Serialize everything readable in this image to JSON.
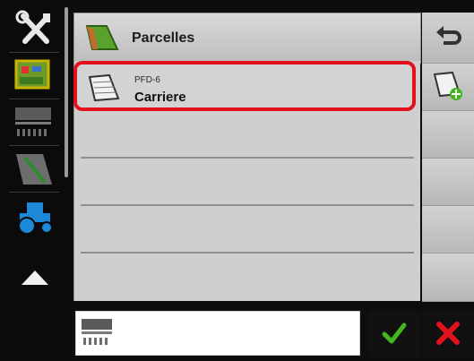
{
  "header": {
    "title": "Parcelles"
  },
  "field_list": {
    "selected": {
      "code": "PFD-6",
      "name": "Carriere"
    },
    "empty_rows": 3
  },
  "icons": {
    "sidebar": [
      "tools-icon",
      "field-map-icon",
      "implement-icon",
      "field-note-icon",
      "tractor-icon",
      "arrow-up-icon",
      "arrow-down-icon"
    ],
    "header": "field-icon",
    "row": "field-outline-icon",
    "right": [
      "back-icon",
      "add-field-icon"
    ],
    "bottom": [
      "implement-icon",
      "check-icon",
      "close-icon"
    ]
  },
  "colors": {
    "selection_border": "#e1121c",
    "confirm": "#43b71d",
    "cancel": "#e1121c"
  }
}
